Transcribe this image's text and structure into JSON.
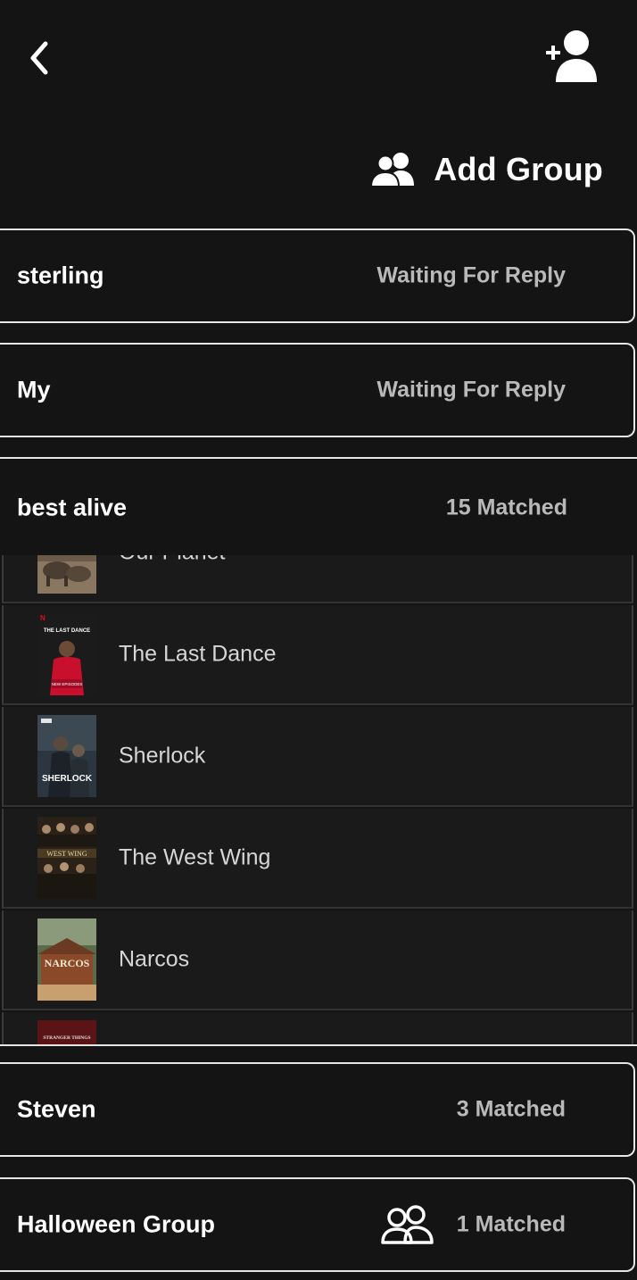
{
  "header": {
    "back_icon": "chevron-left-icon",
    "add_friend_icon": "add-user-icon",
    "add_group": {
      "icon": "group-icon",
      "label": "Add Group"
    }
  },
  "groups": [
    {
      "name": "sterling",
      "status": "Waiting For Reply"
    },
    {
      "name": "My",
      "status": "Waiting For Reply"
    },
    {
      "name": "best alive",
      "status": "15 Matched"
    },
    {
      "name": "Steven",
      "status": "3 Matched"
    },
    {
      "name": "Halloween Group",
      "status": "1 Matched"
    }
  ],
  "shows": [
    {
      "title": "Our Planet",
      "poster_text": ""
    },
    {
      "title": "The Last Dance",
      "poster_text": "THE LAST DANCE"
    },
    {
      "title": "Sherlock",
      "poster_text": "SHERLOCK"
    },
    {
      "title": "The West Wing",
      "poster_text": "WEST WING"
    },
    {
      "title": "Narcos",
      "poster_text": "NARCOS"
    },
    {
      "title": "",
      "poster_text": "STRANGER THINGS"
    }
  ],
  "colors": {
    "background": "#141414",
    "card_border": "#e6e6e6",
    "status_text": "#b9b9b9",
    "row_background": "#1a1a1a"
  }
}
